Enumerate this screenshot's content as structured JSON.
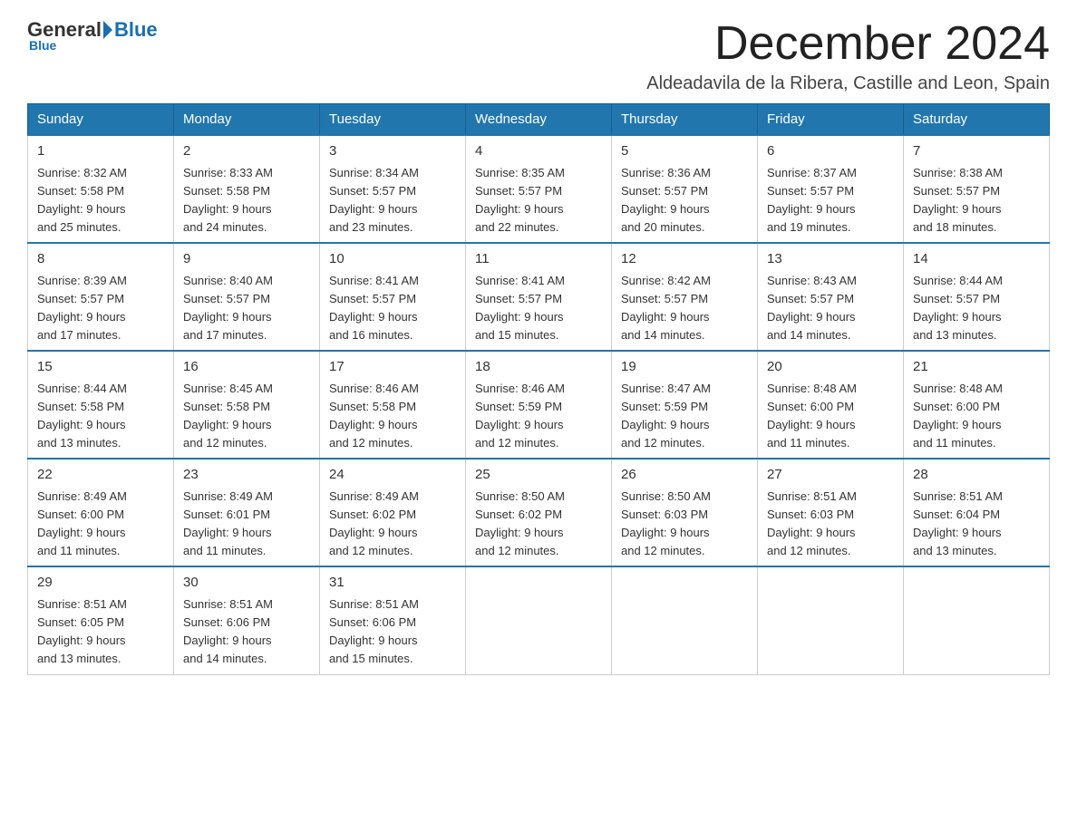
{
  "logo": {
    "general": "General",
    "triangle": "",
    "blue": "Blue"
  },
  "title": "December 2024",
  "location": "Aldeadavila de la Ribera, Castille and Leon, Spain",
  "weekdays": [
    "Sunday",
    "Monday",
    "Tuesday",
    "Wednesday",
    "Thursday",
    "Friday",
    "Saturday"
  ],
  "weeks": [
    [
      {
        "day": "1",
        "info": "Sunrise: 8:32 AM\nSunset: 5:58 PM\nDaylight: 9 hours\nand 25 minutes."
      },
      {
        "day": "2",
        "info": "Sunrise: 8:33 AM\nSunset: 5:58 PM\nDaylight: 9 hours\nand 24 minutes."
      },
      {
        "day": "3",
        "info": "Sunrise: 8:34 AM\nSunset: 5:57 PM\nDaylight: 9 hours\nand 23 minutes."
      },
      {
        "day": "4",
        "info": "Sunrise: 8:35 AM\nSunset: 5:57 PM\nDaylight: 9 hours\nand 22 minutes."
      },
      {
        "day": "5",
        "info": "Sunrise: 8:36 AM\nSunset: 5:57 PM\nDaylight: 9 hours\nand 20 minutes."
      },
      {
        "day": "6",
        "info": "Sunrise: 8:37 AM\nSunset: 5:57 PM\nDaylight: 9 hours\nand 19 minutes."
      },
      {
        "day": "7",
        "info": "Sunrise: 8:38 AM\nSunset: 5:57 PM\nDaylight: 9 hours\nand 18 minutes."
      }
    ],
    [
      {
        "day": "8",
        "info": "Sunrise: 8:39 AM\nSunset: 5:57 PM\nDaylight: 9 hours\nand 17 minutes."
      },
      {
        "day": "9",
        "info": "Sunrise: 8:40 AM\nSunset: 5:57 PM\nDaylight: 9 hours\nand 17 minutes."
      },
      {
        "day": "10",
        "info": "Sunrise: 8:41 AM\nSunset: 5:57 PM\nDaylight: 9 hours\nand 16 minutes."
      },
      {
        "day": "11",
        "info": "Sunrise: 8:41 AM\nSunset: 5:57 PM\nDaylight: 9 hours\nand 15 minutes."
      },
      {
        "day": "12",
        "info": "Sunrise: 8:42 AM\nSunset: 5:57 PM\nDaylight: 9 hours\nand 14 minutes."
      },
      {
        "day": "13",
        "info": "Sunrise: 8:43 AM\nSunset: 5:57 PM\nDaylight: 9 hours\nand 14 minutes."
      },
      {
        "day": "14",
        "info": "Sunrise: 8:44 AM\nSunset: 5:57 PM\nDaylight: 9 hours\nand 13 minutes."
      }
    ],
    [
      {
        "day": "15",
        "info": "Sunrise: 8:44 AM\nSunset: 5:58 PM\nDaylight: 9 hours\nand 13 minutes."
      },
      {
        "day": "16",
        "info": "Sunrise: 8:45 AM\nSunset: 5:58 PM\nDaylight: 9 hours\nand 12 minutes."
      },
      {
        "day": "17",
        "info": "Sunrise: 8:46 AM\nSunset: 5:58 PM\nDaylight: 9 hours\nand 12 minutes."
      },
      {
        "day": "18",
        "info": "Sunrise: 8:46 AM\nSunset: 5:59 PM\nDaylight: 9 hours\nand 12 minutes."
      },
      {
        "day": "19",
        "info": "Sunrise: 8:47 AM\nSunset: 5:59 PM\nDaylight: 9 hours\nand 12 minutes."
      },
      {
        "day": "20",
        "info": "Sunrise: 8:48 AM\nSunset: 6:00 PM\nDaylight: 9 hours\nand 11 minutes."
      },
      {
        "day": "21",
        "info": "Sunrise: 8:48 AM\nSunset: 6:00 PM\nDaylight: 9 hours\nand 11 minutes."
      }
    ],
    [
      {
        "day": "22",
        "info": "Sunrise: 8:49 AM\nSunset: 6:00 PM\nDaylight: 9 hours\nand 11 minutes."
      },
      {
        "day": "23",
        "info": "Sunrise: 8:49 AM\nSunset: 6:01 PM\nDaylight: 9 hours\nand 11 minutes."
      },
      {
        "day": "24",
        "info": "Sunrise: 8:49 AM\nSunset: 6:02 PM\nDaylight: 9 hours\nand 12 minutes."
      },
      {
        "day": "25",
        "info": "Sunrise: 8:50 AM\nSunset: 6:02 PM\nDaylight: 9 hours\nand 12 minutes."
      },
      {
        "day": "26",
        "info": "Sunrise: 8:50 AM\nSunset: 6:03 PM\nDaylight: 9 hours\nand 12 minutes."
      },
      {
        "day": "27",
        "info": "Sunrise: 8:51 AM\nSunset: 6:03 PM\nDaylight: 9 hours\nand 12 minutes."
      },
      {
        "day": "28",
        "info": "Sunrise: 8:51 AM\nSunset: 6:04 PM\nDaylight: 9 hours\nand 13 minutes."
      }
    ],
    [
      {
        "day": "29",
        "info": "Sunrise: 8:51 AM\nSunset: 6:05 PM\nDaylight: 9 hours\nand 13 minutes."
      },
      {
        "day": "30",
        "info": "Sunrise: 8:51 AM\nSunset: 6:06 PM\nDaylight: 9 hours\nand 14 minutes."
      },
      {
        "day": "31",
        "info": "Sunrise: 8:51 AM\nSunset: 6:06 PM\nDaylight: 9 hours\nand 15 minutes."
      },
      null,
      null,
      null,
      null
    ]
  ]
}
